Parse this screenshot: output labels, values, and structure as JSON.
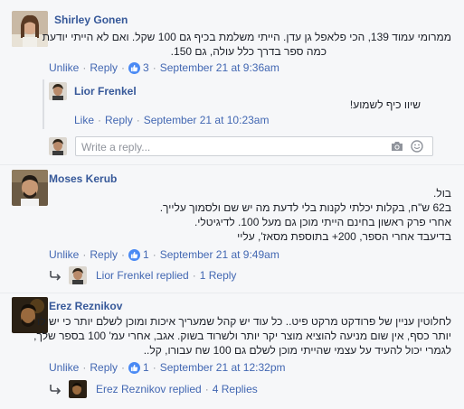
{
  "comments": [
    {
      "author": "Shirley Gonen",
      "lines": [
        "ממרומי עמוד 139, הכי פלאפל גן עדן. הייתי משלמת בכיף גם 100 שקל. ואם לא הייתי יודעת",
        "כמה ספר בדרך כלל עולה, גם 150."
      ],
      "unlike": "Unlike",
      "reply": "Reply",
      "likes": "3",
      "time": "September 21 at 9:36am"
    },
    {
      "author": "Moses Kerub",
      "lines": [
        "בול.",
        "ב62 ש\"ח, בקלות יכלתי לקנות בלי לדעת מה יש שם ולסמוך עלייך.",
        "אחרי פרק ראשון בחינם הייתי מוכן גם מעל 100. לדיגיטלי.",
        "בדיעבד אחרי הספר, 200+ בתוספת מסאז', עליי"
      ],
      "unlike": "Unlike",
      "reply": "Reply",
      "likes": "1",
      "time": "September 21 at 9:49am"
    },
    {
      "author": "Erez Reznikov",
      "lines": [
        "לחלוטין עניין של פרודקט מרקט פיט.. כל עוד יש קהל שמעריך איכות ומוכן לשלם יותר כי יש לו",
        "יותר כסף, אין שום מניעה להוציא מוצר יקר יותר ולשרוד בשוק. אגב, אחרי עמ' 100 בספר שלך,",
        "לגמרי יכול להעיד על עצמי שהייתי מוכן לשלם גם 100 שח עבורו, קל.."
      ],
      "unlike": "Unlike",
      "reply": "Reply",
      "likes": "1",
      "time": "September 21 at 12:32pm"
    }
  ],
  "nested_reply": {
    "author": "Lior Frenkel",
    "text": "שיוו כיף לשמוע!",
    "like": "Like",
    "reply": "Reply",
    "time": "September 21 at 10:23am"
  },
  "reply_input": {
    "placeholder": "Write a reply..."
  },
  "replied_summaries": [
    {
      "name": "Lior Frenkel replied",
      "count": "1 Reply"
    },
    {
      "name": "Erez Reznikov replied",
      "count": "4 Replies"
    }
  ],
  "colors": {
    "link": "#4267b2",
    "name": "#365899",
    "like_badge": "#4a8af4"
  }
}
